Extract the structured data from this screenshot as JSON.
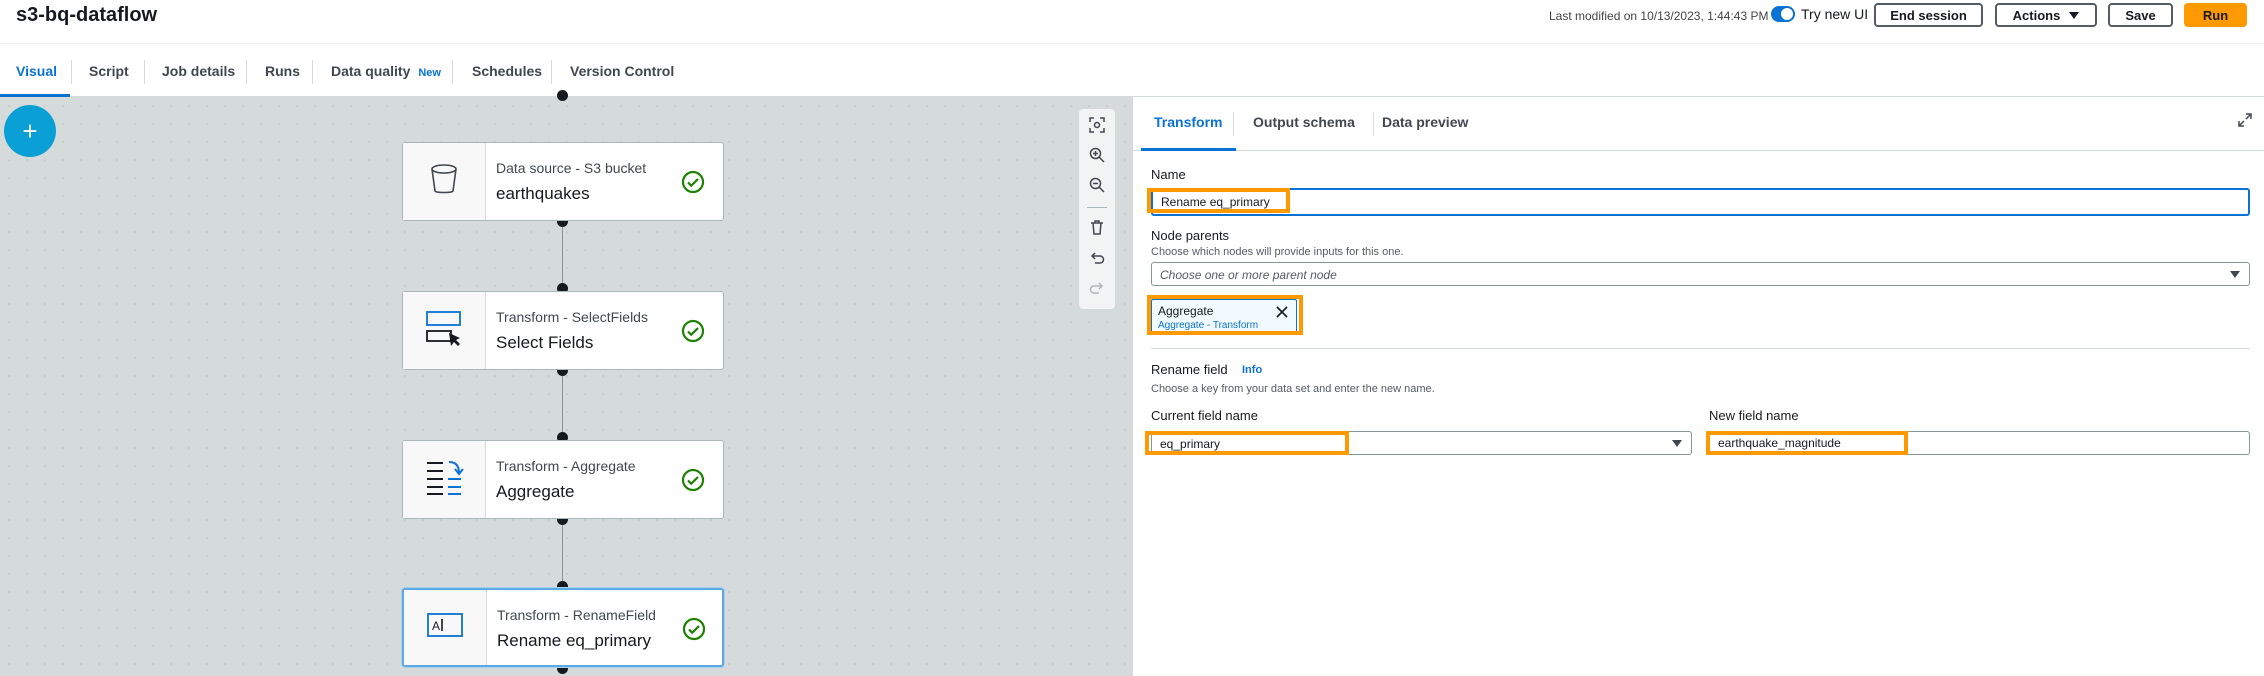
{
  "header": {
    "job_title": "s3-bq-dataflow",
    "last_modified": "Last modified on 10/13/2023, 1:44:43 PM",
    "try_new_ui_label": "Try new UI",
    "try_new_ui_enabled": true,
    "end_session_label": "End session",
    "actions_label": "Actions",
    "save_label": "Save",
    "run_label": "Run"
  },
  "tabs": [
    {
      "label": "Visual",
      "active": true
    },
    {
      "label": "Script"
    },
    {
      "label": "Job details"
    },
    {
      "label": "Runs"
    },
    {
      "label": "Data quality",
      "badge": "New"
    },
    {
      "label": "Schedules"
    },
    {
      "label": "Version Control"
    }
  ],
  "canvas": {
    "add_label": "+",
    "nodes": [
      {
        "subtitle": "Data source - S3 bucket",
        "title": "earthquakes",
        "icon": "bucket-icon",
        "status": "check-circle-icon"
      },
      {
        "subtitle": "Transform - SelectFields",
        "title": "Select Fields",
        "icon": "select-fields-icon",
        "status": "check-circle-icon"
      },
      {
        "subtitle": "Transform - Aggregate",
        "title": "Aggregate",
        "icon": "aggregate-icon",
        "status": "check-circle-icon"
      },
      {
        "subtitle": "Transform - RenameField",
        "title": "Rename eq_primary",
        "icon": "rename-field-icon",
        "status": "check-circle-icon",
        "selected": true
      }
    ],
    "toolbar_icons": [
      "fit-view-icon",
      "zoom-in-icon",
      "zoom-out-icon",
      "trash-icon",
      "undo-icon",
      "redo-icon"
    ]
  },
  "panel": {
    "tabs": [
      {
        "label": "Transform",
        "active": true
      },
      {
        "label": "Output schema"
      },
      {
        "label": "Data preview"
      }
    ],
    "name_label": "Name",
    "name_value": "Rename eq_primary",
    "node_parents_label": "Node parents",
    "node_parents_desc": "Choose which nodes will provide inputs for this one.",
    "node_parents_placeholder": "Choose one or more parent node",
    "parent_token": {
      "title": "Aggregate",
      "subtitle": "Aggregate - Transform"
    },
    "rename_label": "Rename field",
    "info_label": "Info",
    "rename_desc": "Choose a key from your data set and enter the new name.",
    "current_field_label": "Current field name",
    "current_field_value": "eq_primary",
    "new_field_label": "New field name",
    "new_field_value": "earthquake_magnitude"
  },
  "colors": {
    "accent": "#0972d3",
    "run_button": "#ff9900",
    "highlight": "#ff9900",
    "success": "#1d8102",
    "add_button": "#0aa0d6"
  }
}
